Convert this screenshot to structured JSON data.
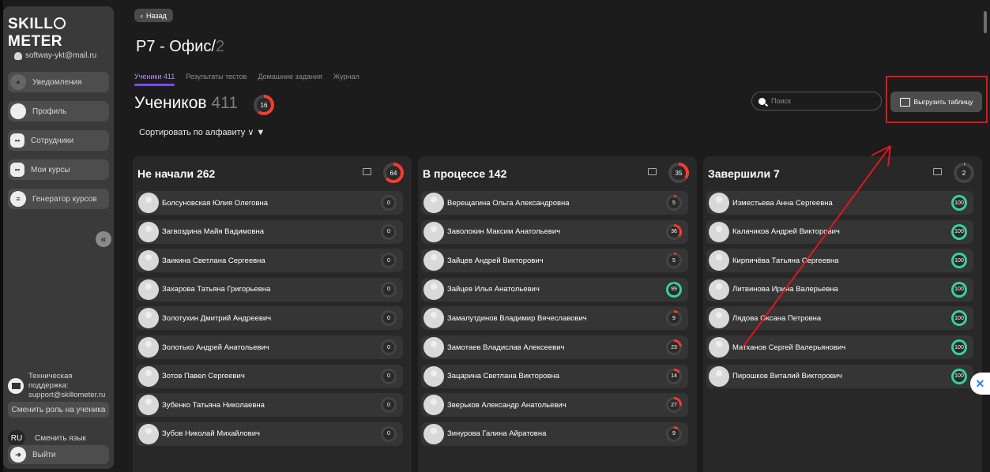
{
  "sidebar": {
    "logo": "SKILLOMETER",
    "logo_pre": "SKILL",
    "logo_post": "METER",
    "email": "softway-ykt@mail.ru",
    "items": [
      {
        "label": "Уведомления",
        "icon": "bell-icon"
      },
      {
        "label": "Профиль",
        "icon": "user-icon"
      },
      {
        "label": "Сотрудники",
        "icon": "id-card-icon"
      },
      {
        "label": "Мои курсы",
        "icon": "id-card-icon"
      },
      {
        "label": "Генератор курсов",
        "icon": "database-icon"
      }
    ],
    "collapse_glyph": "«",
    "support_line1": "Техническая поддержка:",
    "support_line2": "support@skillometer.ru",
    "switch_role": "Сменить роль на ученика",
    "lang_code": "RU",
    "switch_lang": "Сменить язык",
    "logout": "Выйти"
  },
  "header": {
    "back_label": "Назад",
    "back_glyph": "‹",
    "title_main": "Р7 - Офис/",
    "title_dim": "2"
  },
  "tabs": [
    {
      "label": "Ученики 411",
      "active": true
    },
    {
      "label": "Результаты тестов",
      "active": false
    },
    {
      "label": "Домашние задания",
      "active": false
    },
    {
      "label": "Журнал",
      "active": false
    }
  ],
  "students": {
    "title": "Учеников",
    "count": "411",
    "badge": "16",
    "sort_label": "Сортировать по алфавиту ∨ ▼"
  },
  "search": {
    "placeholder": "Поиск"
  },
  "export_label": "Выгрузить таблицу",
  "float_widget_glyph": "✕",
  "colors": {
    "accent": "#7a4dff",
    "red": "#ff3b30",
    "green": "#34d399",
    "highlight": "#e0161e"
  },
  "columns": [
    {
      "title": "Не начали 262",
      "badge": "64",
      "students": [
        {
          "name": "Болсуновская Юлия Олеговна",
          "score": "0"
        },
        {
          "name": "Загвоздина Майя Вадимовна",
          "score": "0"
        },
        {
          "name": "Заикина Светлана Сергеевна",
          "score": "0"
        },
        {
          "name": "Захарова Татьяна Григорьевна",
          "score": "0"
        },
        {
          "name": "Золотухин Дмитрий Андреевич",
          "score": "0"
        },
        {
          "name": "Золотько Андрей Анатольевич",
          "score": "0"
        },
        {
          "name": "Зотов Павел Сергеевич",
          "score": "0"
        },
        {
          "name": "Зубенко Татьяна Николаевна",
          "score": "0"
        },
        {
          "name": "Зубов Николай Михайлович",
          "score": "0"
        }
      ]
    },
    {
      "title": "В процессе 142",
      "badge": "35",
      "students": [
        {
          "name": "Верещагина Ольга Александровна",
          "score": "5"
        },
        {
          "name": "Заволокин Максим Анатольевич",
          "score": "36"
        },
        {
          "name": "Зайцев Андрей Викторович",
          "score": "5"
        },
        {
          "name": "Зайцев Илья Анатольевич",
          "score": "99"
        },
        {
          "name": "Замалутдинов Владимир Вячеславович",
          "score": "9"
        },
        {
          "name": "Замотаев Владислав Алексеевич",
          "score": "23"
        },
        {
          "name": "Зацарина Светлана Викторовна",
          "score": "14"
        },
        {
          "name": "Зверьков Александр Анатольевич",
          "score": "27"
        },
        {
          "name": "Зинурова Галина Айратовна",
          "score": "9"
        }
      ]
    },
    {
      "title": "Завершили 7",
      "badge": "2",
      "students": [
        {
          "name": "Изместьева Анна Сергеевна",
          "score": "100"
        },
        {
          "name": "Калачиков Андрей Викторович",
          "score": "100"
        },
        {
          "name": "Кирпичёва Татьяна Сергеевна",
          "score": "100"
        },
        {
          "name": "Литвинова Ирина Валерьевна",
          "score": "100"
        },
        {
          "name": "Лядова Оксана Петровна",
          "score": "100"
        },
        {
          "name": "Матханов Сергей Валерьянович",
          "score": "100"
        },
        {
          "name": "Пирошков Виталий Викторович",
          "score": "100"
        }
      ]
    }
  ]
}
